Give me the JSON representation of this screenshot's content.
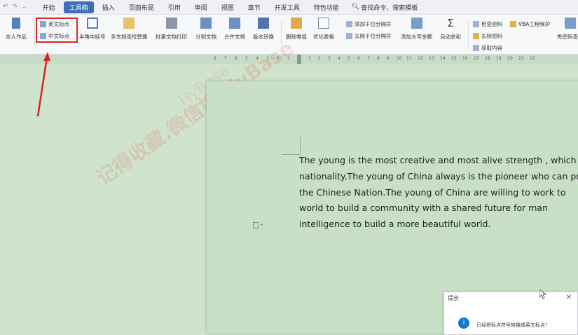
{
  "tabs": [
    "开始",
    "工具箱",
    "插入",
    "页面布局",
    "引用",
    "审阅",
    "视图",
    "章节",
    "开发工具",
    "特色功能"
  ],
  "active_tab": "工具箱",
  "search_text": "查找命令、搜索模板",
  "ribbon": {
    "my_work": "本人作品",
    "english_punct": "英文标点",
    "chinese_punct": "中文标点",
    "half_brackets": "半角中括号",
    "multi_find_replace": "多文档查找替换",
    "batch_print": "批量文档打印",
    "split_doc": "分割文档",
    "merge_doc": "合并文档",
    "version_convert": "版本转换",
    "delete_zero": "删除零值",
    "optimize_table": "优化表格",
    "add_thousands": "添加千位分隔符",
    "remove_thousands": "去除千位分隔符",
    "add_uppercase_amount": "添加大写金额",
    "auto_sum": "自动求和",
    "check_password": "检查密码",
    "remove_password": "去除密码",
    "get_content": "获取内容",
    "vba_protect": "VBA工程保护",
    "password_free": "免密码查看"
  },
  "ruler": {
    "left_ticks": [
      "8",
      "7",
      "6",
      "5",
      "4",
      "3",
      "2",
      "1"
    ],
    "right_ticks": [
      "1",
      "2",
      "3",
      "4",
      "5",
      "6",
      "7",
      "8",
      "9",
      "10",
      "11",
      "12",
      "13",
      "14",
      "15",
      "16",
      "17",
      "18",
      "19",
      "20",
      "21",
      "22"
    ]
  },
  "document": {
    "lines": [
      "The young is the most creative and most alive strength , which",
      "nationality.The young of China always is the pioneer who can pr",
      "the Chinese Nation.The young of China are willing to work to",
      "world to build a community with a shared future for man",
      "intelligence to build a more beautiful world."
    ]
  },
  "watermark": "记得收藏.微信搜·HyBase",
  "watermark2": "HyBase",
  "dialog": {
    "title": "提示",
    "message": "已经将标点符号转换成英文标点！"
  },
  "colors": {
    "accent": "#3f6fb6",
    "highlight": "#d62b2b",
    "page_bg": "#c8e0c6"
  }
}
